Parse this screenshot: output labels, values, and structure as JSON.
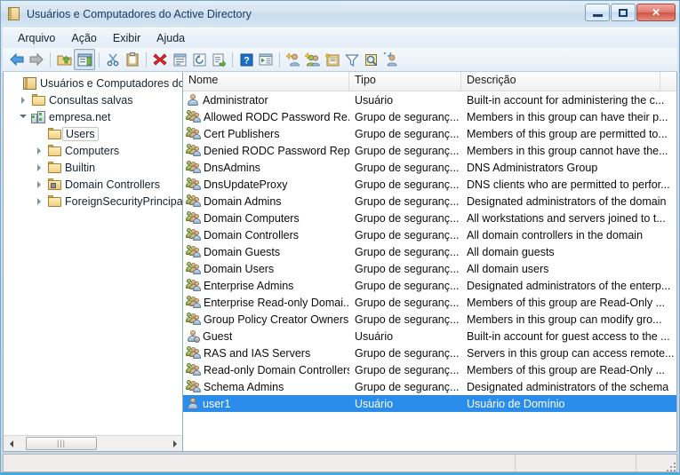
{
  "window": {
    "title": "Usuários e Computadores do Active Directory",
    "icon": "console-snapin-icon",
    "buttons": {
      "minimize": "Minimizar",
      "maximize": "Maximizar",
      "close": "Fechar"
    }
  },
  "menubar": {
    "items": [
      {
        "label": "Arquivo",
        "name": "menu-arquivo"
      },
      {
        "label": "Ação",
        "name": "menu-acao"
      },
      {
        "label": "Exibir",
        "name": "menu-exibir"
      },
      {
        "label": "Ajuda",
        "name": "menu-ajuda"
      }
    ]
  },
  "toolbar": {
    "buttons": [
      {
        "name": "back-icon",
        "title": "Voltar"
      },
      {
        "name": "forward-icon",
        "title": "Avançar"
      },
      {
        "sep": true
      },
      {
        "name": "up-folder-icon",
        "title": "Um nível acima"
      },
      {
        "name": "show-console-tree-icon",
        "title": "Mostrar/Ocultar árvore do console",
        "pressed": true
      },
      {
        "sep": true
      },
      {
        "name": "cut-icon",
        "title": "Recortar"
      },
      {
        "name": "paste-icon",
        "title": "Colar"
      },
      {
        "sep": true
      },
      {
        "name": "delete-icon",
        "title": "Excluir"
      },
      {
        "name": "properties-icon",
        "title": "Propriedades"
      },
      {
        "name": "refresh-icon",
        "title": "Atualizar"
      },
      {
        "name": "export-list-icon",
        "title": "Exportar lista"
      },
      {
        "sep": true
      },
      {
        "name": "help-icon",
        "title": "Ajuda"
      },
      {
        "name": "run-icon",
        "title": "Executar"
      },
      {
        "sep": true
      },
      {
        "name": "new-user-icon",
        "title": "Novo usuário"
      },
      {
        "name": "new-group-icon",
        "title": "Novo grupo"
      },
      {
        "name": "new-ou-icon",
        "title": "Nova unidade organizacional"
      },
      {
        "name": "filter-icon",
        "title": "Filtrar"
      },
      {
        "name": "find-icon",
        "title": "Localizar"
      },
      {
        "name": "user-action-icon",
        "title": "Ações do usuário"
      }
    ]
  },
  "tree": {
    "nodes": [
      {
        "label": "Usuários e Computadores do Ac",
        "icon": "console-root-icon",
        "indent": 0,
        "twisty": "none",
        "selected": false
      },
      {
        "label": "Consultas salvas",
        "icon": "folder-icon",
        "indent": 1,
        "twisty": "closed",
        "selected": false
      },
      {
        "label": "empresa.net",
        "icon": "domain-icon",
        "indent": 1,
        "twisty": "open",
        "selected": false
      },
      {
        "label": "Users",
        "icon": "folder-icon",
        "indent": 2,
        "twisty": "none",
        "selected": true
      },
      {
        "label": "Computers",
        "icon": "folder-icon",
        "indent": 2,
        "twisty": "closed",
        "selected": false
      },
      {
        "label": "Builtin",
        "icon": "folder-icon",
        "indent": 2,
        "twisty": "closed",
        "selected": false
      },
      {
        "label": "Domain Controllers",
        "icon": "folder-dc-icon",
        "indent": 2,
        "twisty": "closed",
        "selected": false
      },
      {
        "label": "ForeignSecurityPrincipals",
        "icon": "folder-icon",
        "indent": 2,
        "twisty": "closed",
        "selected": false
      }
    ],
    "hscroll": {
      "left_arrow": "◄",
      "right_arrow": "►",
      "grip": "|||"
    }
  },
  "list": {
    "columns": [
      {
        "label": "Nome",
        "name": "column-header-nome"
      },
      {
        "label": "Tipo",
        "name": "column-header-tipo"
      },
      {
        "label": "Descrição",
        "name": "column-header-descricao"
      }
    ],
    "rows": [
      {
        "name": "Administrator",
        "type": "Usuário",
        "desc": "Built-in account for administering the c...",
        "icon": "user-icon",
        "selected": false
      },
      {
        "name": "Allowed RODC Password Re...",
        "type": "Grupo de seguranç...",
        "desc": "Members in this group can have their p...",
        "icon": "group-icon",
        "selected": false
      },
      {
        "name": "Cert Publishers",
        "type": "Grupo de seguranç...",
        "desc": "Members of this group are permitted to...",
        "icon": "group-icon",
        "selected": false
      },
      {
        "name": "Denied RODC Password Repl...",
        "type": "Grupo de seguranç...",
        "desc": "Members in this group cannot have the...",
        "icon": "group-icon",
        "selected": false
      },
      {
        "name": "DnsAdmins",
        "type": "Grupo de seguranç...",
        "desc": "DNS Administrators Group",
        "icon": "group-icon",
        "selected": false
      },
      {
        "name": "DnsUpdateProxy",
        "type": "Grupo de seguranç...",
        "desc": "DNS clients who are permitted to perfor...",
        "icon": "group-icon",
        "selected": false
      },
      {
        "name": "Domain Admins",
        "type": "Grupo de seguranç...",
        "desc": "Designated administrators of the domain",
        "icon": "group-icon",
        "selected": false
      },
      {
        "name": "Domain Computers",
        "type": "Grupo de seguranç...",
        "desc": "All workstations and servers joined to t...",
        "icon": "group-icon",
        "selected": false
      },
      {
        "name": "Domain Controllers",
        "type": "Grupo de seguranç...",
        "desc": "All domain controllers in the domain",
        "icon": "group-icon",
        "selected": false
      },
      {
        "name": "Domain Guests",
        "type": "Grupo de seguranç...",
        "desc": "All domain guests",
        "icon": "group-icon",
        "selected": false
      },
      {
        "name": "Domain Users",
        "type": "Grupo de seguranç...",
        "desc": "All domain users",
        "icon": "group-icon",
        "selected": false
      },
      {
        "name": "Enterprise Admins",
        "type": "Grupo de seguranç...",
        "desc": "Designated administrators of the enterp...",
        "icon": "group-icon",
        "selected": false
      },
      {
        "name": "Enterprise Read-only Domai...",
        "type": "Grupo de seguranç...",
        "desc": "Members of this group are Read-Only ...",
        "icon": "group-icon",
        "selected": false
      },
      {
        "name": "Group Policy Creator Owners",
        "type": "Grupo de seguranç...",
        "desc": "Members in this group can modify gro...",
        "icon": "group-icon",
        "selected": false
      },
      {
        "name": "Guest",
        "type": "Usuário",
        "desc": "Built-in account for guest access to the ...",
        "icon": "user-disabled-icon",
        "selected": false
      },
      {
        "name": "RAS and IAS Servers",
        "type": "Grupo de seguranç...",
        "desc": "Servers in this group can access remote...",
        "icon": "group-icon",
        "selected": false
      },
      {
        "name": "Read-only Domain Controllers",
        "type": "Grupo de seguranç...",
        "desc": "Members of this group are Read-Only ...",
        "icon": "group-icon",
        "selected": false
      },
      {
        "name": "Schema Admins",
        "type": "Grupo de seguranç...",
        "desc": "Designated administrators of the schema",
        "icon": "group-icon",
        "selected": false
      },
      {
        "name": "user1",
        "type": "Usuário",
        "desc": "Usuário de Domínio",
        "icon": "user-icon",
        "selected": true
      }
    ]
  },
  "statusbar": {
    "left": "",
    "middle": "",
    "right": ""
  },
  "colors": {
    "selection": "#2a8dec",
    "frame": "#c4d8ea",
    "accent_bottom": "#4aa8d8"
  }
}
